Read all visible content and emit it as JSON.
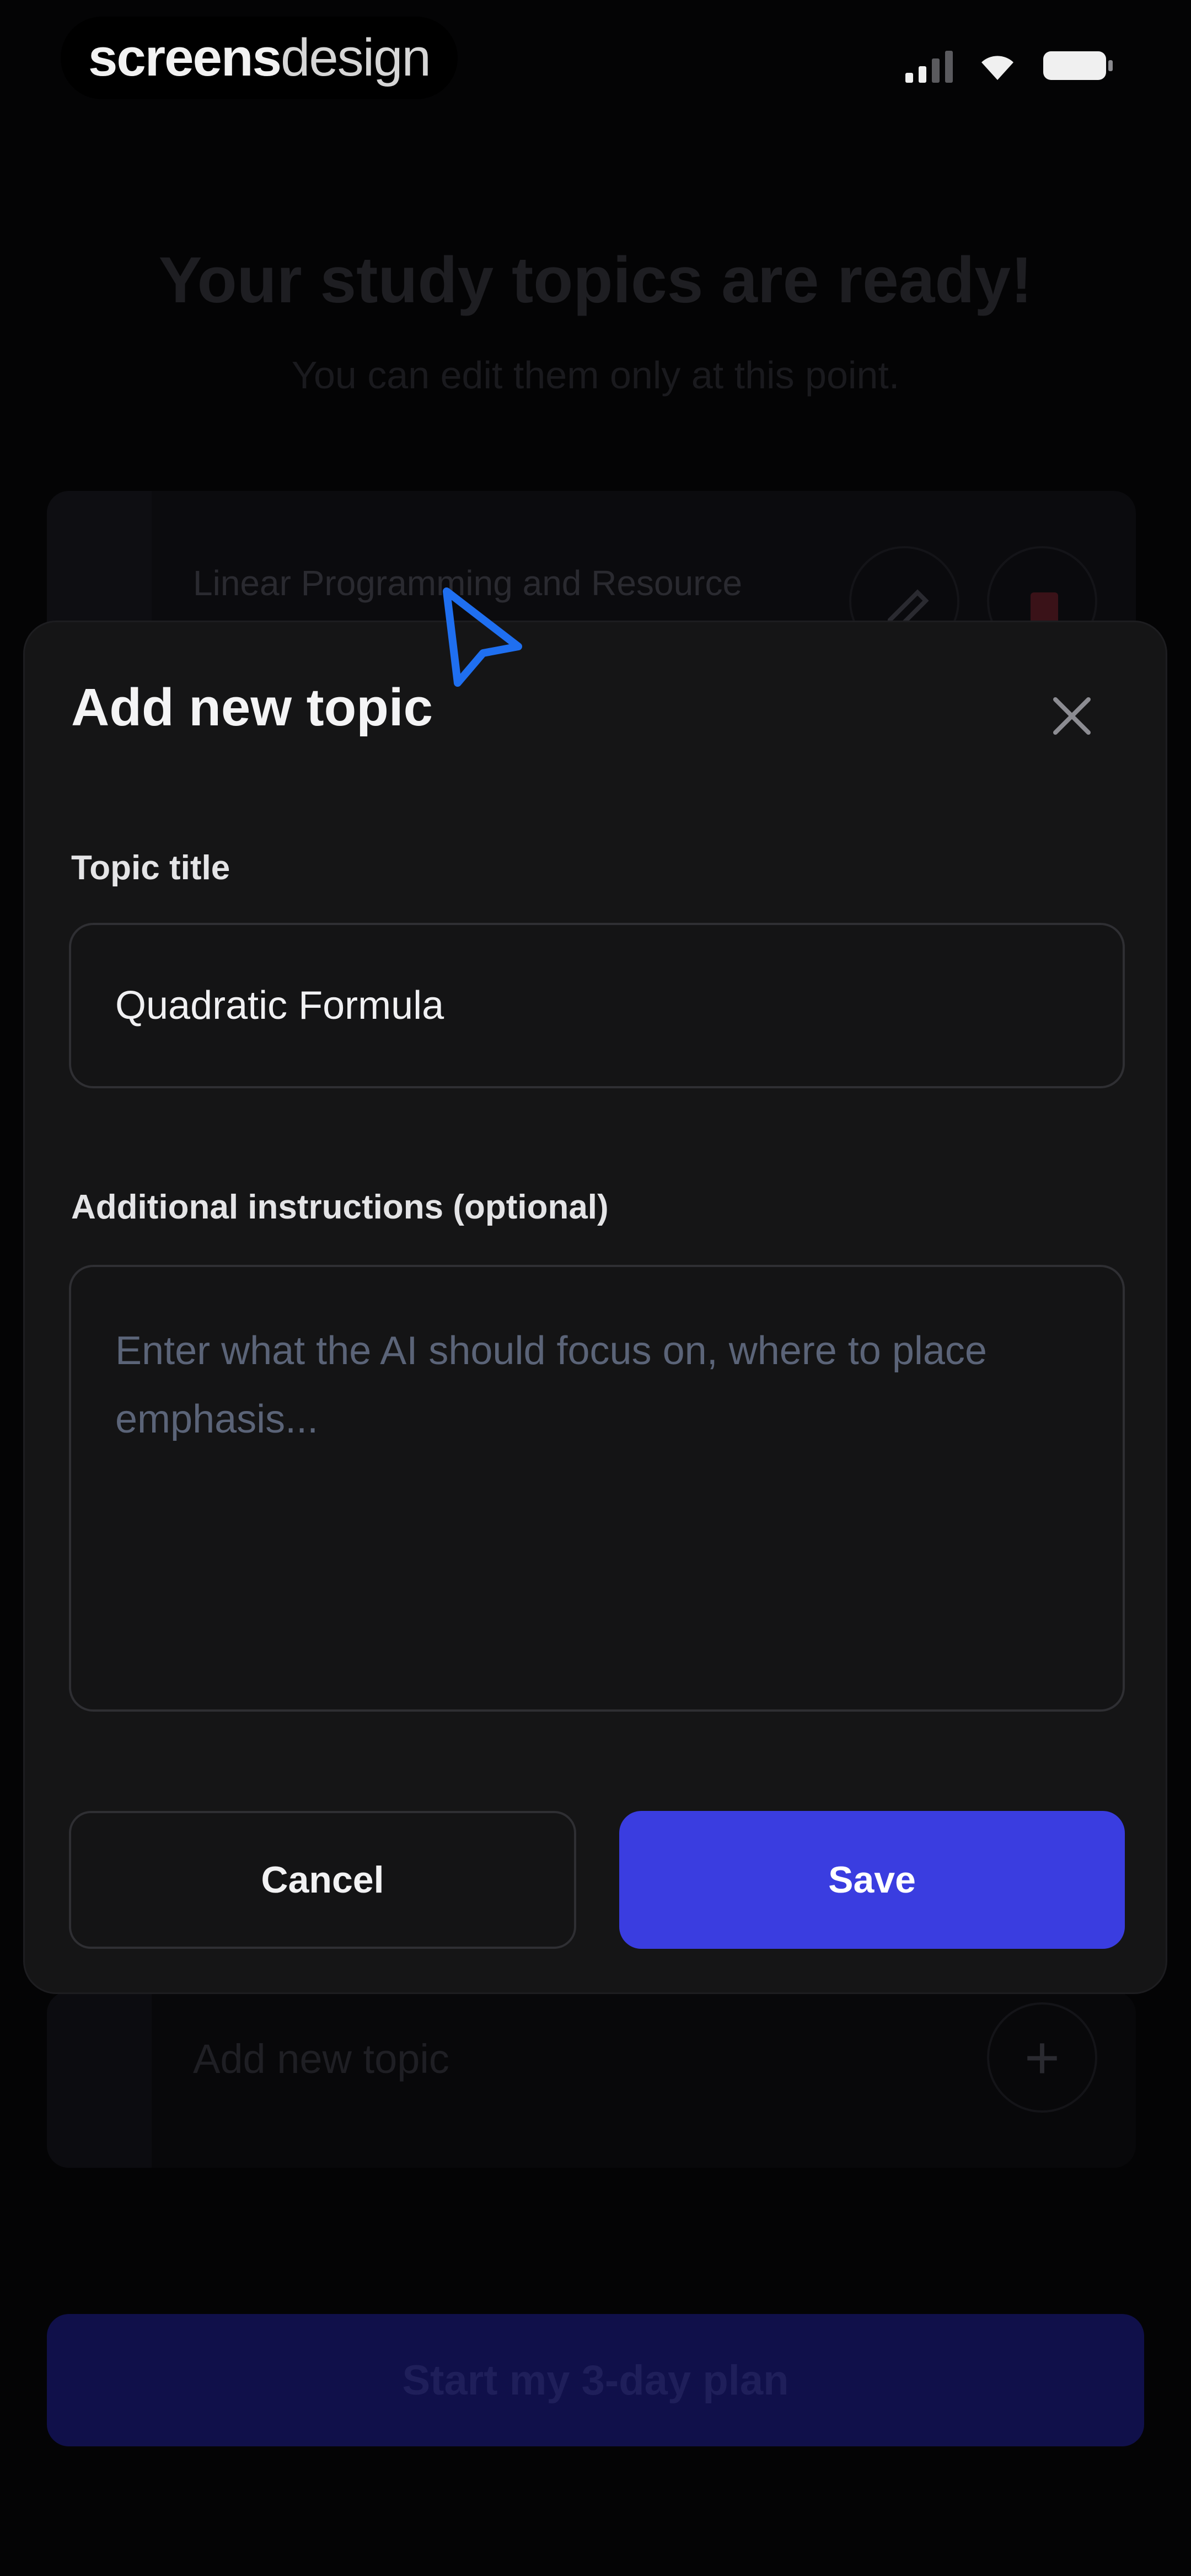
{
  "status_bar": {
    "watermark_bold": "screens",
    "watermark_light": "design"
  },
  "background": {
    "title": "Your study topics are ready!",
    "subtitle": "You can edit them only at this point.",
    "first_topic": "Linear Programming and Resource",
    "add_topic_label": "Add new topic",
    "add_topic_plus": "+",
    "start_button": "Start my 3-day plan"
  },
  "modal": {
    "title": "Add new topic",
    "topic_title_label": "Topic title",
    "topic_title_value": "Quadratic Formula",
    "instructions_label": "Additional instructions (optional)",
    "instructions_placeholder": "Enter what the AI should focus on, where to place emphasis...",
    "cancel_label": "Cancel",
    "save_label": "Save"
  },
  "colors": {
    "accent": "#3a3de0",
    "modal_background": "#151516",
    "screen_background": "#040405",
    "cursor": "#1f6ff0"
  },
  "icons": [
    "signal-icon",
    "wifi-icon",
    "battery-icon",
    "close-icon",
    "edit-icon",
    "delete-icon",
    "cursor-icon"
  ]
}
